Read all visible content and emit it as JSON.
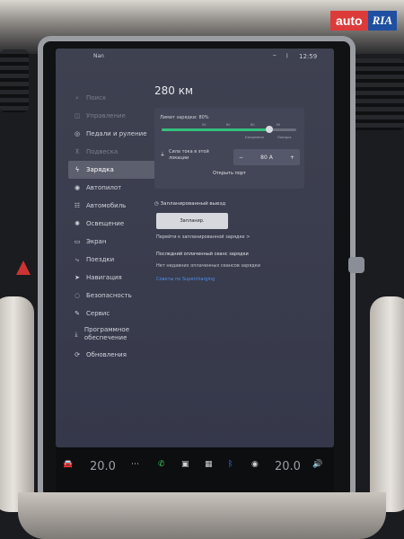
{
  "watermark": {
    "auto": "auto",
    "ria": "RIA"
  },
  "status": {
    "user": "Nan",
    "time": "12:59"
  },
  "sidebar": {
    "items": [
      {
        "label": "Поиск",
        "icon": "search-icon",
        "glyph": "⌕",
        "state": "dim"
      },
      {
        "label": "Управление",
        "icon": "car-icon",
        "glyph": "◫",
        "state": "dim"
      },
      {
        "label": "Педали и руление",
        "icon": "steering-icon",
        "glyph": "◎",
        "state": "normal"
      },
      {
        "label": "Подвеска",
        "icon": "suspension-icon",
        "glyph": "⊼",
        "state": "dim"
      },
      {
        "label": "Зарядка",
        "icon": "bolt-icon",
        "glyph": "ϟ",
        "state": "active"
      },
      {
        "label": "Автопилот",
        "icon": "wheel-icon",
        "glyph": "◉",
        "state": "normal"
      },
      {
        "label": "Автомобиль",
        "icon": "sliders-icon",
        "glyph": "☷",
        "state": "normal"
      },
      {
        "label": "Освещение",
        "icon": "light-icon",
        "glyph": "✺",
        "state": "normal"
      },
      {
        "label": "Экран",
        "icon": "display-icon",
        "glyph": "▭",
        "state": "normal"
      },
      {
        "label": "Поездки",
        "icon": "trips-icon",
        "glyph": "⤷",
        "state": "normal"
      },
      {
        "label": "Навигация",
        "icon": "navigation-icon",
        "glyph": "➤",
        "state": "normal"
      },
      {
        "label": "Безопасность",
        "icon": "shield-icon",
        "glyph": "◌",
        "state": "normal"
      },
      {
        "label": "Сервис",
        "icon": "wrench-icon",
        "glyph": "✎",
        "state": "normal"
      },
      {
        "label": "Программное обеспечение",
        "icon": "download-icon",
        "glyph": "⤓",
        "state": "normal"
      },
      {
        "label": "Обновления",
        "icon": "updates-icon",
        "glyph": "⟳",
        "state": "normal"
      }
    ]
  },
  "charging": {
    "range": "280 км",
    "limit_label": "Лимит зарядки: 80%",
    "limit_value": 0.8,
    "ticks": [
      "50",
      "60",
      "80",
      "90"
    ],
    "marks": [
      "Ежедневно",
      "Поездка"
    ],
    "current_label": "Сила тока в этой локации",
    "current_minus": "−",
    "current_value": "80 A",
    "current_plus": "+",
    "open_port": "Открыть порт",
    "scheduled_title": "Запланированный выезд",
    "schedule_button": "Запланир.",
    "goto_scheduled": "Перейти к запланированной зарядке >",
    "last_title": "Последний оплаченный сеанс зарядки",
    "last_value": "Нет недавних оплаченных сеансов зарядки",
    "supercharging_link": "Советы по Supercharging",
    "accent": "#35c07d"
  },
  "taskbar": {
    "temp_left": "20.0",
    "temp_right": "20.0",
    "items": [
      "car-icon",
      "dots-icon",
      "phone-icon",
      "media-icon",
      "apps-icon",
      "bluetooth-icon",
      "camera-icon",
      "volume-icon"
    ]
  }
}
